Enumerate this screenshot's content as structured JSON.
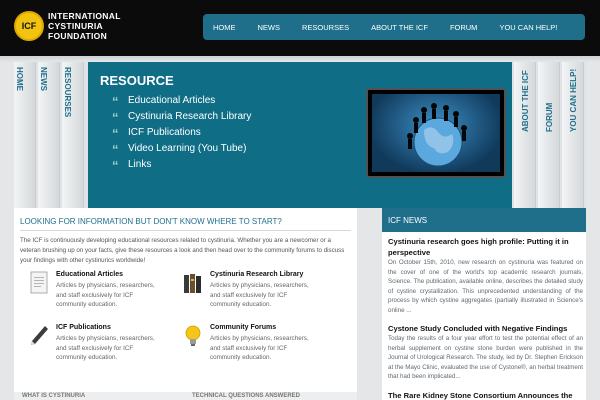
{
  "logo": {
    "badge": "ICF",
    "line1": "INTERNATIONAL",
    "line2": "CYSTINURIA",
    "line3": "FOUNDATION"
  },
  "nav": [
    "HOME",
    "NEWS",
    "RESOURSES",
    "ABOUT THE ICF",
    "FORUM",
    "YOU CAN HELP!"
  ],
  "side_tabs_left": [
    "HOME",
    "NEWS",
    "RESOURSES"
  ],
  "side_tabs_right": [
    "ABOUT THE ICF",
    "FORUM",
    "YOU CAN HELP!"
  ],
  "resource": {
    "title": "RESOURCE",
    "items": [
      "Educational Articles",
      "Cystinuria Research Library",
      "ICF Publications",
      "Video Learning (You Tube)",
      "Links"
    ]
  },
  "main": {
    "title": "LOOKING FOR INFORMATION BUT DON'T KNOW WHERE TO START?",
    "intro": "The ICF is continuously developing educational resources related to cystinuria. Whether you are a newcomer or a veteran brushing up on your facts, give these resources a look and then head over to the community forums to discuss your findings with other cystinurics worldwide!",
    "cards": [
      {
        "title": "Educational Articles",
        "desc": "Articles by physicians, researchers, and staff exclusively for ICF community education.",
        "icon": "document-icon"
      },
      {
        "title": "Cystinuria Research Library",
        "desc": "Articles by physicians, researchers, and staff exclusively for ICF community education.",
        "icon": "books-icon"
      },
      {
        "title": "ICF Publications",
        "desc": "Articles by physicians, researchers, and staff exclusively for ICF community education.",
        "icon": "pen-icon"
      },
      {
        "title": "Community Forums",
        "desc": "Articles by physicians, researchers, and staff exclusively for ICF community education.",
        "icon": "lightbulb-icon"
      }
    ],
    "bottom_left": "WHAT IS CYSTINURIA",
    "bottom_right": "TECHNICAL QUESTIONS ANSWERED"
  },
  "news": {
    "header": "ICF NEWS",
    "items": [
      {
        "title": "Cystinuria research goes high profile: Putting it in perspective",
        "body": "On October 15th, 2010, new research on cystinuria was featured on the cover of one of the world's top academic research journals, Science. The publication, available online, describes the detailed study of cystine crystallization. This unprecedented understanding of the process by which cystine aggregates (partially illustrated in Science's online ..."
      },
      {
        "title": "Cystone Study Concluded with Negative Findings",
        "body": "Today the results of a four year effort to test the potential effect of an herbal supplement on cystine stone burden were published in the Journal of Urological Research. The study, led by Dr. Stephen Erickson at the Mayo Clinic, evaluated the use of Cystone®, an herbal treatment that had been implicated..."
      },
      {
        "title": "The Rare Kidney Stone Consortium Announces the",
        "body": ""
      }
    ]
  },
  "colors": {
    "accent": "#1f6f8b",
    "banner": "#0f6e86",
    "header": "#0b0b0b"
  }
}
